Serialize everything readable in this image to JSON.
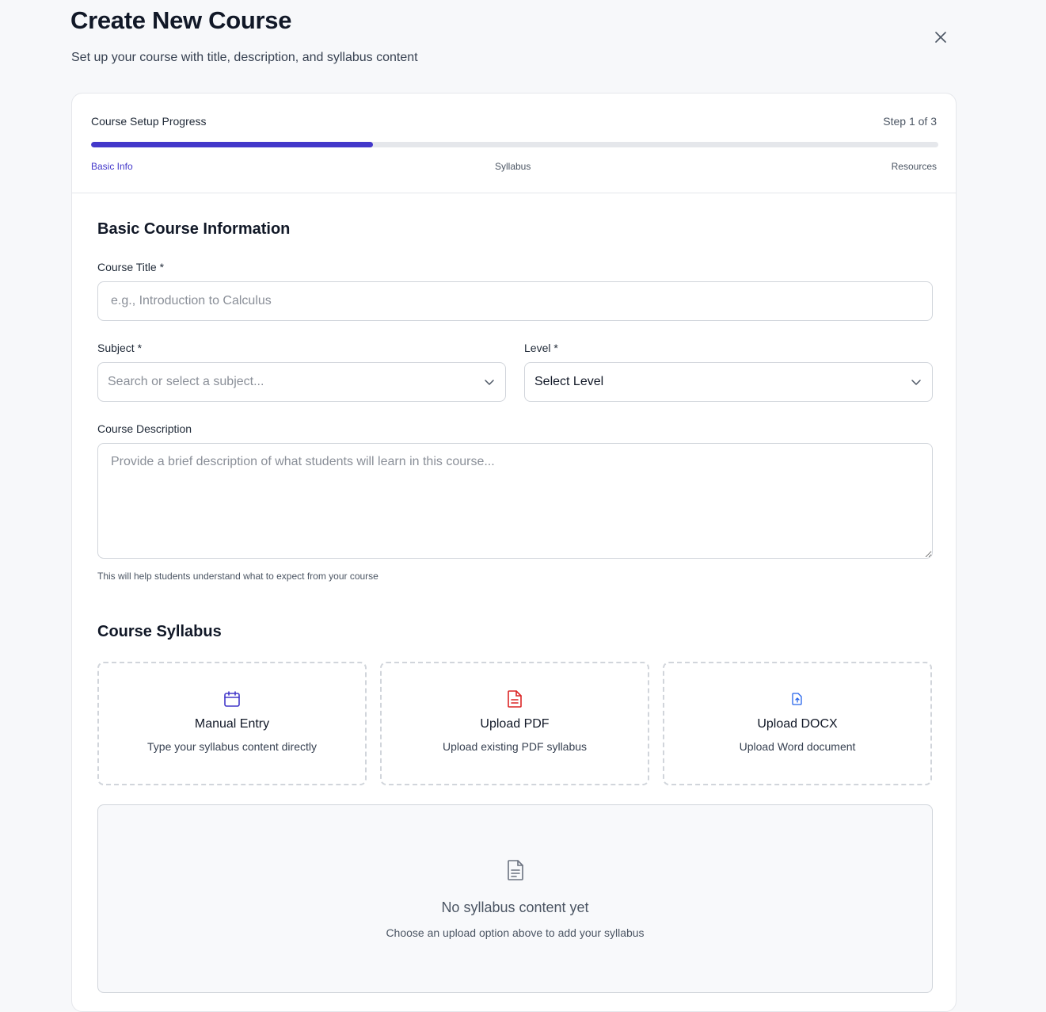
{
  "header": {
    "title": "Create New Course",
    "subtitle": "Set up your course with title, description, and syllabus content",
    "close_icon": "close-icon"
  },
  "progress": {
    "label": "Course Setup Progress",
    "step_text": "Step 1 of 3",
    "fraction": 0.333,
    "accent_color": "#4338ca",
    "steps": [
      {
        "label": "Basic Info",
        "active": true
      },
      {
        "label": "Syllabus",
        "active": false
      },
      {
        "label": "Resources",
        "active": false
      }
    ]
  },
  "basic_info": {
    "heading": "Basic Course Information",
    "course_title": {
      "label": "Course Title *",
      "placeholder": "e.g., Introduction to Calculus",
      "value": ""
    },
    "subject": {
      "label": "Subject *",
      "placeholder": "Search or select a subject...",
      "icon": "chevron-down-icon"
    },
    "level": {
      "label": "Level *",
      "selected": "Select Level",
      "icon": "chevron-down-icon"
    },
    "description": {
      "label": "Course Description",
      "placeholder": "Provide a brief description of what students will learn in this course...",
      "helper": "This will help students understand what to expect from your course"
    }
  },
  "syllabus": {
    "heading": "Course Syllabus",
    "options": [
      {
        "title": "Manual Entry",
        "description": "Type your syllabus content directly",
        "icon": "calendar-icon",
        "color": "#4338ca"
      },
      {
        "title": "Upload PDF",
        "description": "Upload existing PDF syllabus",
        "icon": "file-text-icon",
        "color": "#dc2626"
      },
      {
        "title": "Upload DOCX",
        "description": "Upload Word document",
        "icon": "file-upload-icon",
        "color": "#2563eb"
      }
    ],
    "empty_state": {
      "title": "No syllabus content yet",
      "description": "Choose an upload option above to add your syllabus",
      "icon": "document-icon"
    }
  }
}
